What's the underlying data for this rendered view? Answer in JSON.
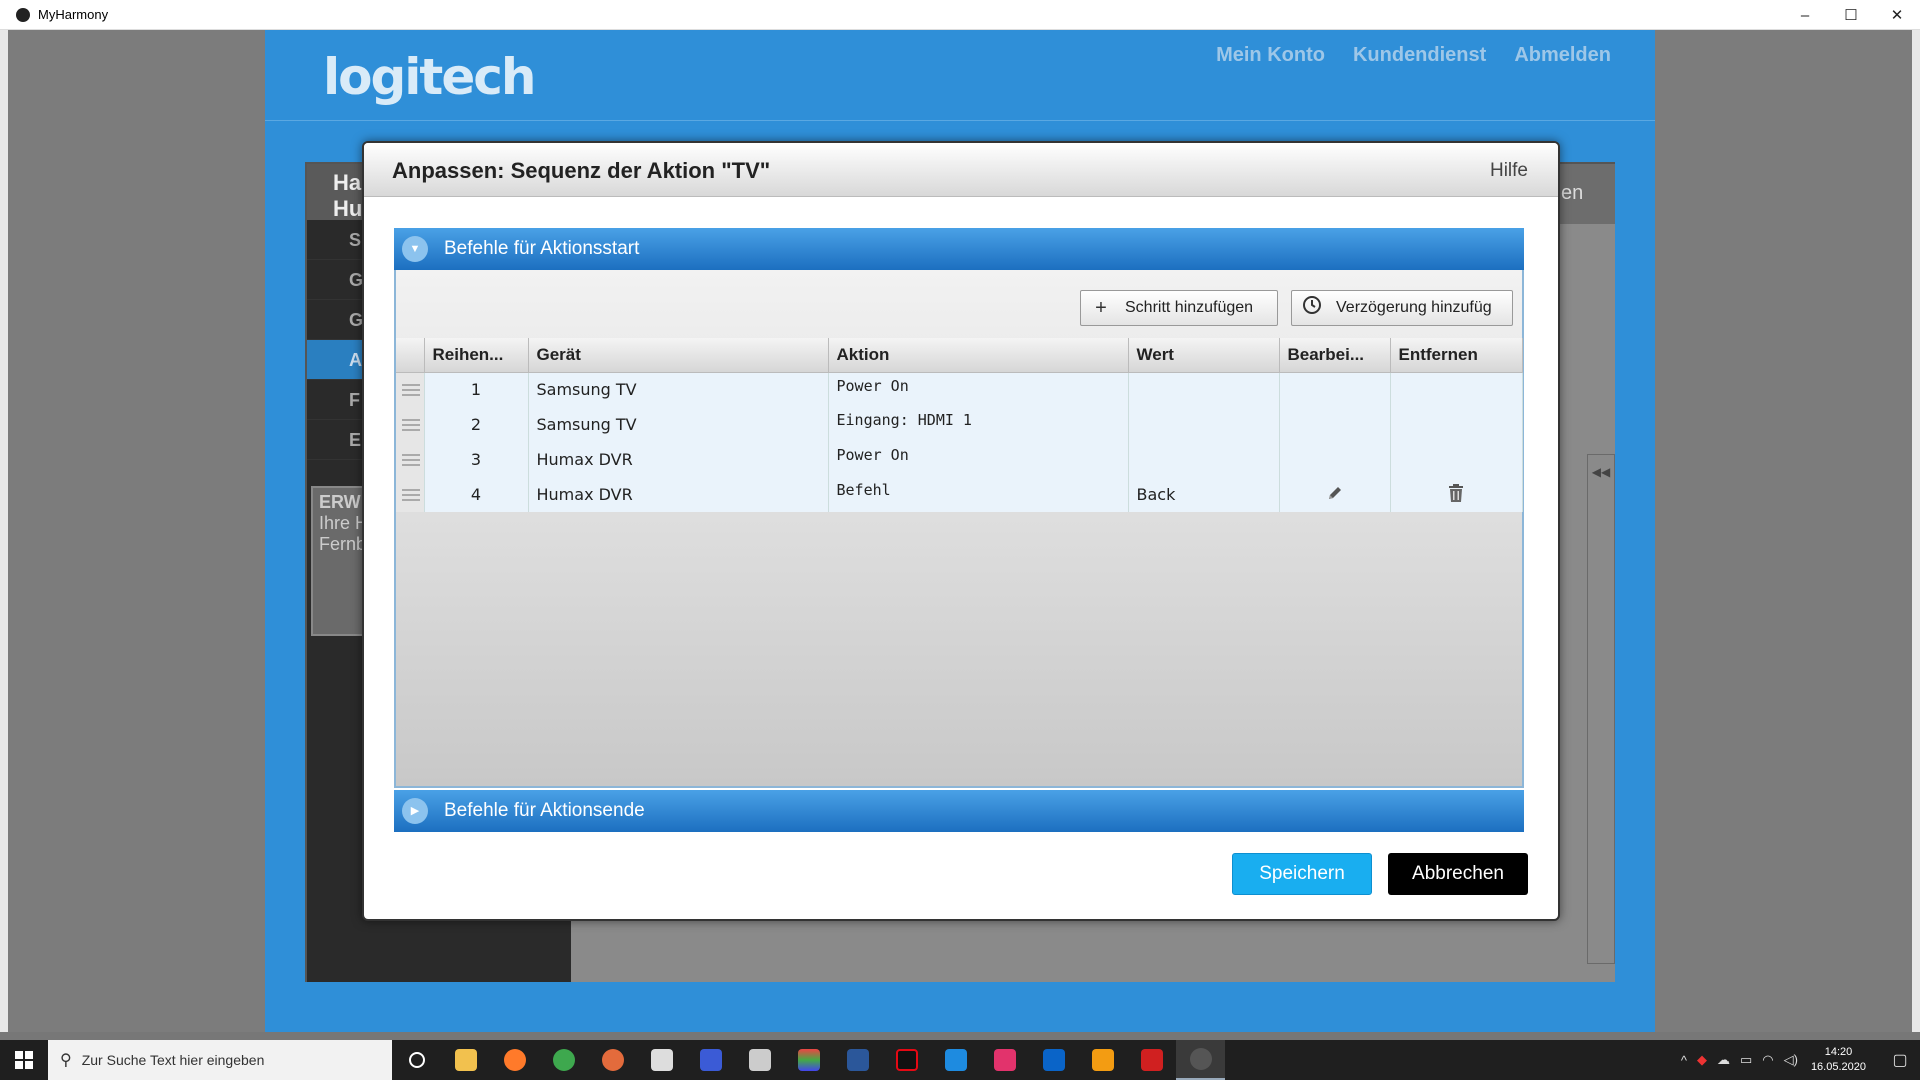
{
  "window": {
    "title": "MyHarmony",
    "controls": [
      "–",
      "☐",
      "✕"
    ]
  },
  "header": {
    "logo": "logitech",
    "nav": [
      "Mein Konto",
      "Kundendienst",
      "Abmelden"
    ]
  },
  "background": {
    "sidebar_head": "Ha\nHu",
    "sidebar_items": [
      "S",
      "G",
      "G",
      "A",
      "F",
      "E"
    ],
    "card_title": "ERW",
    "card_lines": [
      "Ihre H",
      "Fernb"
    ],
    "tab_partial": "en"
  },
  "dialog": {
    "title": "Anpassen: Sequenz der Aktion \"TV\"",
    "help": "Hilfe",
    "section_start": "Befehle für Aktionsstart",
    "section_end": "Befehle für Aktionsende",
    "add_step": "Schritt hinzufügen",
    "add_delay": "Verzögerung hinzufüg",
    "columns": [
      "Reihen...",
      "Gerät",
      "Aktion",
      "Wert",
      "Bearbei...",
      "Entfernen"
    ],
    "rows": [
      {
        "seq": "1",
        "device": "Samsung TV",
        "action": "Power On",
        "value": ""
      },
      {
        "seq": "2",
        "device": "Samsung TV",
        "action": "Eingang: HDMI 1",
        "value": ""
      },
      {
        "seq": "3",
        "device": "Humax DVR",
        "action": "Power On",
        "value": ""
      },
      {
        "seq": "4",
        "device": "Humax DVR",
        "action": "Befehl",
        "value": "Back"
      }
    ],
    "save": "Speichern",
    "cancel": "Abbrechen"
  },
  "taskbar": {
    "search_placeholder": "Zur Suche Text hier eingeben",
    "time": "14:20",
    "date": "16.05.2020"
  },
  "colors": {
    "accent": "#2f8fd8",
    "save": "#19aef0",
    "section": "#1c6fc0"
  }
}
